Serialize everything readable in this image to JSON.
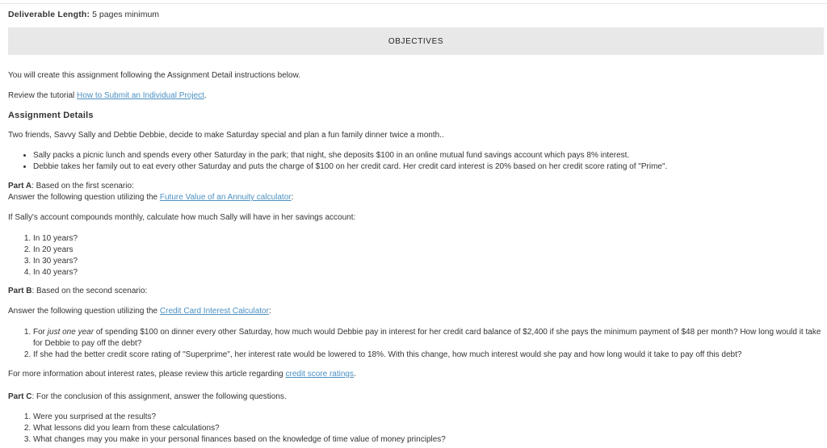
{
  "deliverable": {
    "key": "Deliverable Length:",
    "value": "5 pages minimum"
  },
  "objectives": "OBJECTIVES",
  "intro": "You will create this assignment following the Assignment Detail instructions below.",
  "review": {
    "prefix": "Review the tutorial ",
    "link": "How to Submit an Individual Project",
    "suffix": "."
  },
  "assignment_heading": "Assignment Details",
  "scenario": "Two friends, Savvy Sally and Debtie Debbie, decide to make Saturday special and plan a fun family dinner twice a month..",
  "bullets": [
    "Sally packs a picnic lunch and spends every other Saturday in the park; that night, she deposits $100 in an online mutual fund savings account which pays 8% interest.",
    "Debbie takes her family out to eat every other Saturday and puts the charge of $100 on her credit card. Her credit card interest is 20% based on her credit score rating of \"Prime\"."
  ],
  "partA": {
    "label": "Part A",
    "text": ": Based on the first scenario:",
    "answer_prefix": "Answer the following question utilizing the ",
    "answer_link": "Future Value of an Annuity calculator",
    "answer_suffix": ":",
    "question": "If Sally's account compounds monthly, calculate how much Sally will have in her savings account:",
    "items": [
      "In 10 years?",
      "In 20 years",
      "In 30 years?",
      "In 40 years?"
    ]
  },
  "partB": {
    "label": "Part B",
    "text": ": Based on the second scenario:",
    "answer_prefix": "Answer the following question utilizing the ",
    "answer_link": "Credit Card Interest Calculator",
    "answer_suffix": ":",
    "item1": {
      "pre": "For ",
      "em": "just one year",
      "post": " of spending $100 on dinner every other Saturday, how much would Debbie pay in interest for her credit card balance of $2,400 if she pays the minimum payment of $48 per month? How long would it take for Debbie to pay off  the debt?"
    },
    "item2": "If she had the better credit score rating of \"Superprime\", her interest rate would be lowered to 18%. With this change, how much interest would she pay and how long would it take to pay off this debt?"
  },
  "more_info": {
    "prefix": "For more information about interest rates, please review this article regarding ",
    "link": "credit score ratings",
    "suffix": "."
  },
  "partC": {
    "label": "Part C",
    "text": ": For the conclusion of this assignment, answer the following questions.",
    "items": [
      "Were you surprised at the results?",
      "What lessons did you learn from these calculations?",
      "What changes may you make in your personal finances based on the knowledge of time value of money principles?"
    ]
  }
}
